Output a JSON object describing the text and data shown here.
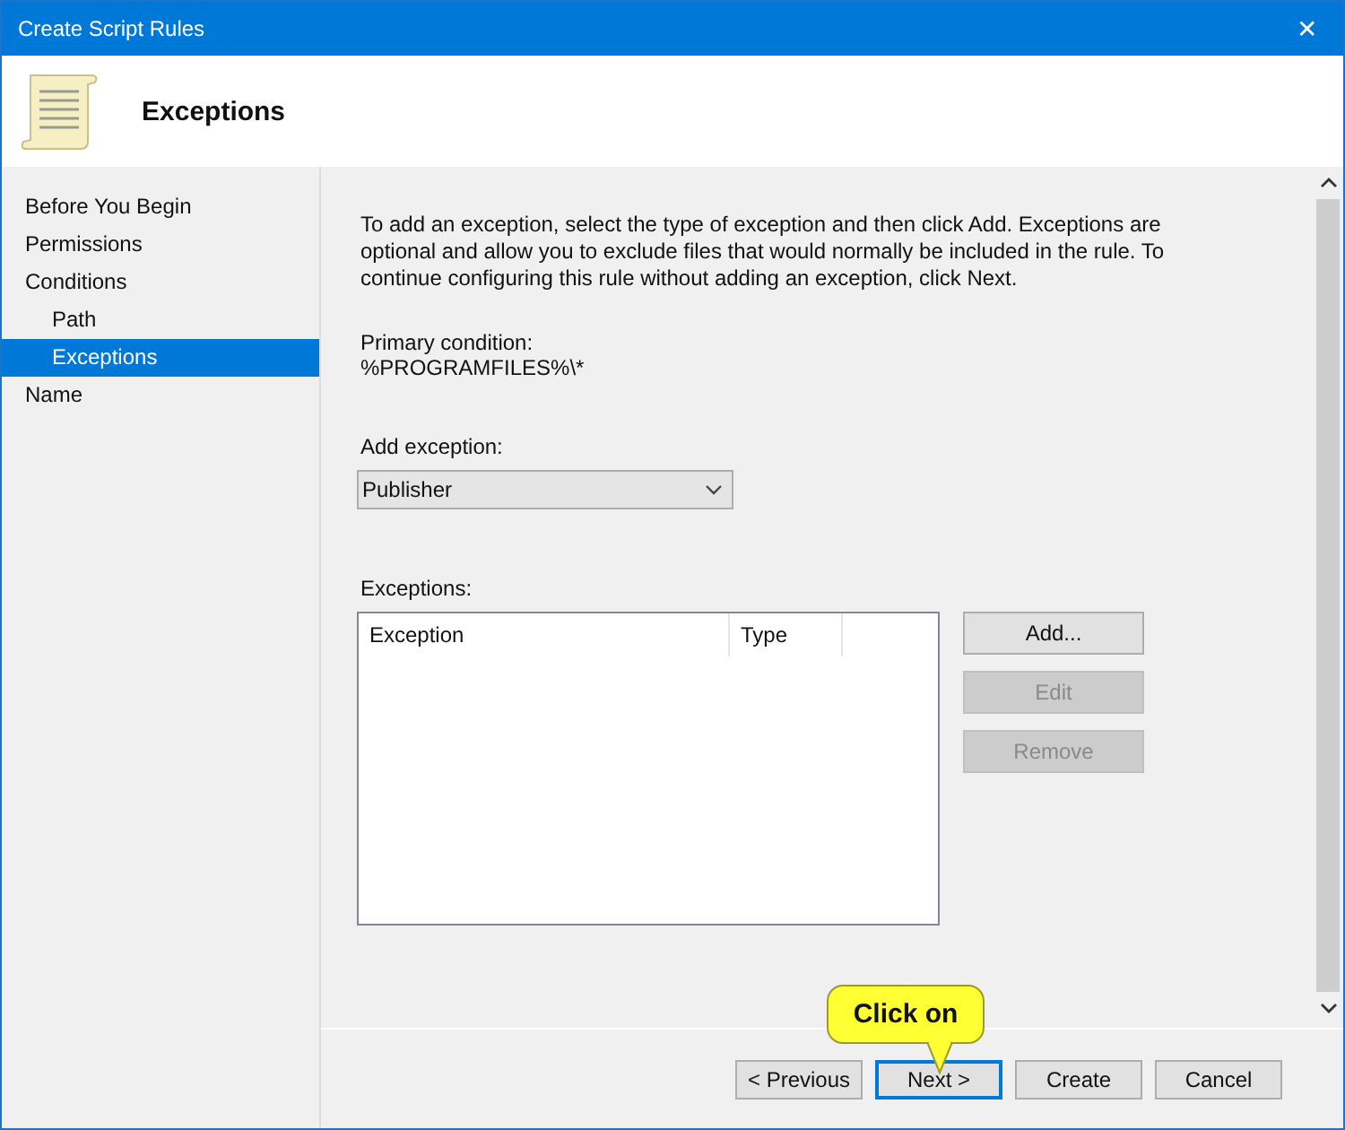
{
  "window": {
    "title": "Create Script Rules",
    "close": "✕"
  },
  "header": {
    "title": "Exceptions"
  },
  "sidebar": {
    "items": [
      {
        "label": "Before You Begin",
        "selected": false
      },
      {
        "label": "Permissions",
        "selected": false
      },
      {
        "label": "Conditions",
        "selected": false,
        "children": [
          {
            "label": "Path",
            "selected": false
          },
          {
            "label": "Exceptions",
            "selected": true
          }
        ]
      },
      {
        "label": "Name",
        "selected": false
      }
    ]
  },
  "content": {
    "intro": "To add an exception, select the type of exception and then click Add. Exceptions are optional and allow you to exclude files that would normally be included in the rule. To continue configuring this rule without adding an exception, click Next.",
    "primary_condition_label": "Primary condition:",
    "primary_condition_value": "%PROGRAMFILES%\\*",
    "add_exception": {
      "label": "Add exception:",
      "value": "Publisher"
    },
    "exceptions": {
      "label": "Exceptions:",
      "columns": [
        "Exception",
        "Type"
      ]
    },
    "side_buttons": [
      {
        "label": "Add...",
        "disabled": false
      },
      {
        "label": "Edit",
        "disabled": true
      },
      {
        "label": "Remove",
        "disabled": true
      }
    ]
  },
  "footer_buttons": [
    {
      "label": "< Previous",
      "default": false
    },
    {
      "label": "Next >",
      "default": true
    },
    {
      "label": "Create",
      "default": false
    },
    {
      "label": "Cancel",
      "default": false
    }
  ],
  "callout": {
    "text": "Click on"
  }
}
